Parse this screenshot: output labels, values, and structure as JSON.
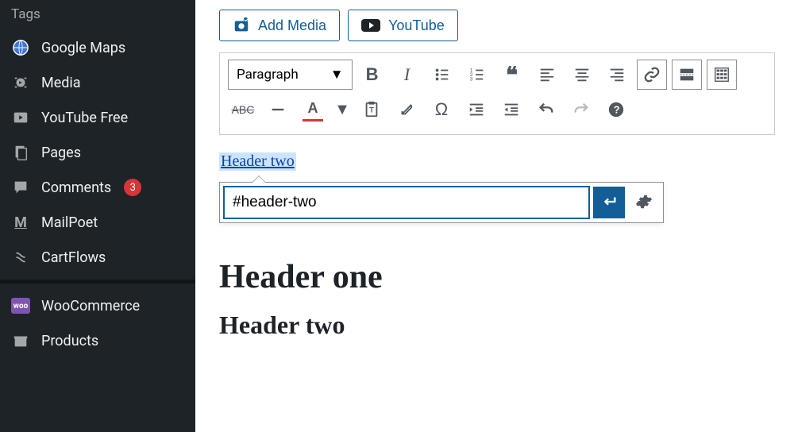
{
  "sidebar": {
    "heading": "Tags",
    "items": [
      {
        "label": "Google Maps"
      },
      {
        "label": "Media"
      },
      {
        "label": "YouTube Free"
      },
      {
        "label": "Pages"
      },
      {
        "label": "Comments",
        "badge": "3"
      },
      {
        "label": "MailPoet"
      },
      {
        "label": "CartFlows"
      }
    ],
    "items2": [
      {
        "label": "WooCommerce"
      },
      {
        "label": "Products"
      }
    ]
  },
  "toolbar": {
    "add_media": "Add Media",
    "youtube": "YouTube",
    "format_label": "Paragraph"
  },
  "editor": {
    "linked_text": "Header two",
    "url_value": "#header-two",
    "h1": "Header one",
    "h2": "Header two"
  }
}
